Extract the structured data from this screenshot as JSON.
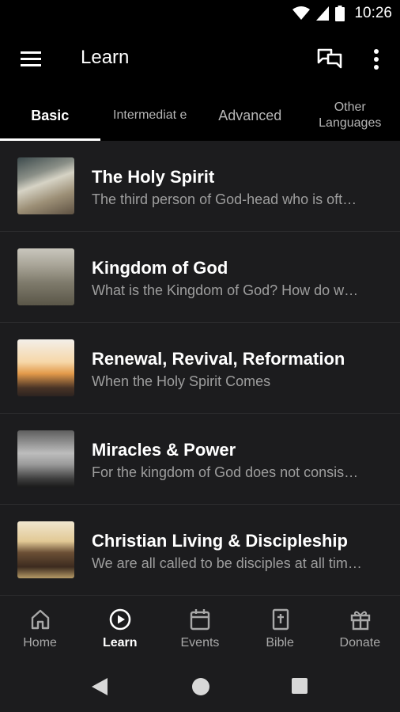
{
  "status": {
    "time": "10:26"
  },
  "appbar": {
    "title": "Learn"
  },
  "tabs": [
    {
      "label": "Basic"
    },
    {
      "label": "Intermediat e"
    },
    {
      "label": "Advanced"
    },
    {
      "label": "Other Languages"
    }
  ],
  "items": [
    {
      "title": "The Holy Spirit",
      "subtitle": "The third person of God-head who is oft…"
    },
    {
      "title": "Kingdom of God",
      "subtitle": "What is the Kingdom of God? How do w…"
    },
    {
      "title": "Renewal, Revival, Reformation",
      "subtitle": "When the Holy Spirit Comes"
    },
    {
      "title": "Miracles & Power",
      "subtitle": "For the kingdom of God does not consis…"
    },
    {
      "title": "Christian Living & Discipleship",
      "subtitle": "We are all called to be disciples at all tim…"
    }
  ],
  "nav": [
    {
      "label": "Home",
      "icon": "home-icon"
    },
    {
      "label": "Learn",
      "icon": "play-circle-icon"
    },
    {
      "label": "Events",
      "icon": "calendar-icon"
    },
    {
      "label": "Bible",
      "icon": "bible-icon"
    },
    {
      "label": "Donate",
      "icon": "gift-icon"
    }
  ],
  "colors": {
    "background": "#000000",
    "list_background": "#1c1c1e",
    "active": "#ffffff",
    "inactive": "#a8a8a8"
  }
}
